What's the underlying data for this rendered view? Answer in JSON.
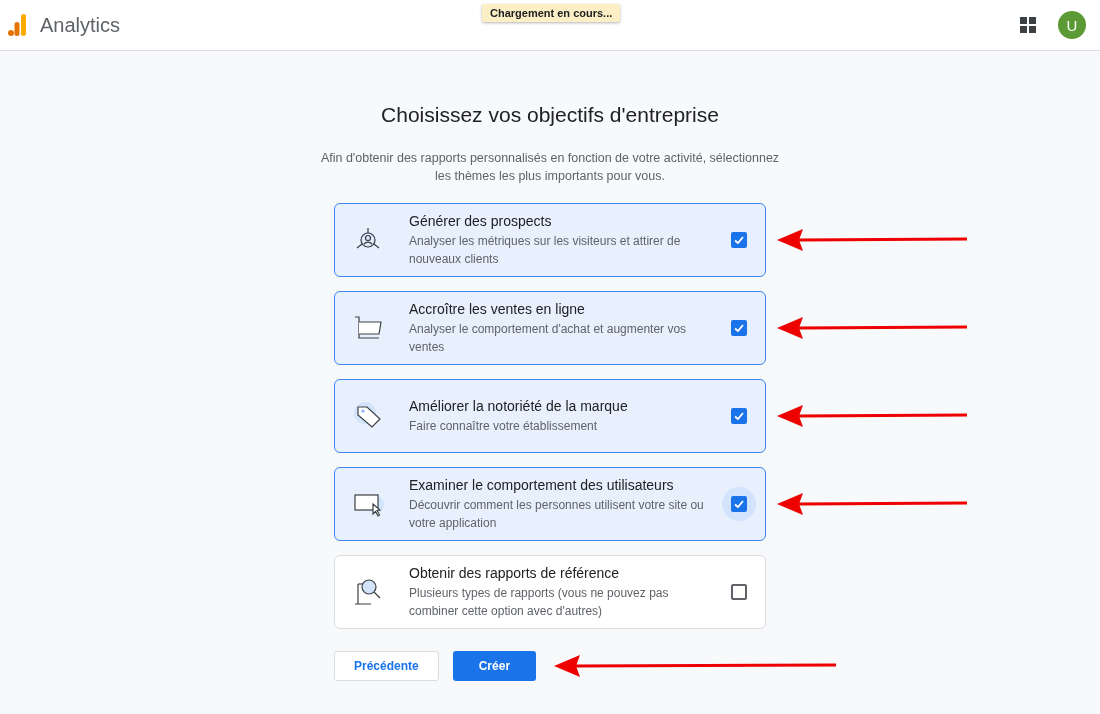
{
  "header": {
    "title": "Analytics",
    "loading_tip": "Chargement en cours...",
    "avatar_letter": "U"
  },
  "page": {
    "title": "Choisissez vos objectifs d'entreprise",
    "subtitle": "Afin d'obtenir des rapports personnalisés en fonction de votre activité, sélectionnez les thèmes les plus importants pour vous."
  },
  "goals": [
    {
      "kind": "leads",
      "title": "Générer des prospects",
      "description": "Analyser les métriques sur les visiteurs et attirer de nouveaux clients",
      "checked": true,
      "focused": false,
      "annotated": true
    },
    {
      "kind": "sales",
      "title": "Accroître les ventes en ligne",
      "description": "Analyser le comportement d'achat et augmenter vos ventes",
      "checked": true,
      "focused": false,
      "annotated": true
    },
    {
      "kind": "brand",
      "title": "Améliorer la notoriété de la marque",
      "description": "Faire connaître votre établissement",
      "checked": true,
      "focused": false,
      "annotated": true
    },
    {
      "kind": "behavior",
      "title": "Examiner le comportement des utilisateurs",
      "description": "Découvrir comment les personnes utilisent votre site ou votre application",
      "checked": true,
      "focused": true,
      "annotated": true
    },
    {
      "kind": "reports",
      "title": "Obtenir des rapports de référence",
      "description": "Plusieurs types de rapports (vous ne pouvez pas combiner cette option avec d'autres)",
      "checked": false,
      "focused": false,
      "annotated": false
    }
  ],
  "buttons": {
    "back": "Précédente",
    "create": "Créer",
    "create_annotated": true
  }
}
